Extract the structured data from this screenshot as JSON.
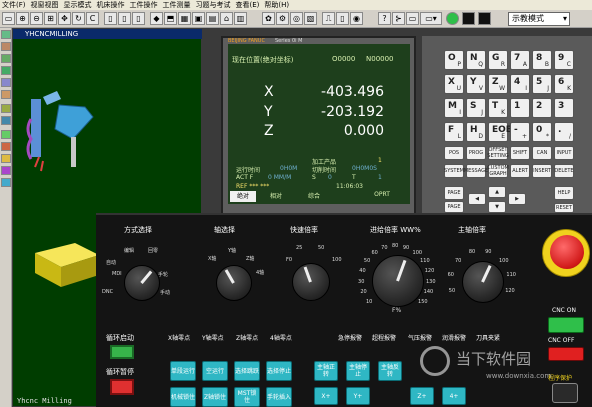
{
  "menubar": [
    "文件(F)",
    "视窗视图",
    "显示模式",
    "机床操作",
    "工件操作",
    "工件测量",
    "习题与考试",
    "查看(E)",
    "帮助(H)"
  ],
  "toolbar": {
    "mode_select": "示教模式"
  },
  "viewport": {
    "title": "YHCNCMILLING",
    "watermark": "Yhcnc Milling"
  },
  "cnc": {
    "header_logo": "BEIJING FANUC",
    "header_series": "Series 0i M",
    "screen_title": "现在位置(绝对坐标)",
    "program_no": "O0000",
    "seq_no": "N00000",
    "axes": [
      {
        "name": "X",
        "value": "-403.496"
      },
      {
        "name": "Y",
        "value": "-203.192"
      },
      {
        "name": "Z",
        "value": "0.000"
      }
    ],
    "run_time_label": "运行时间",
    "run_time": "0H0M",
    "parts_label": "加工产品",
    "parts_count": "1",
    "cycle_time_label": "切削时间",
    "cycle_time": "0H0M0S",
    "act_f_label": "ACT F",
    "act_f": "0 MM/M",
    "s_label": "S",
    "s_value": "0",
    "t_label": "T",
    "t_value": "1",
    "ref_label": "REF *** ***",
    "clock": "11:06:03",
    "softkeys": [
      "绝对",
      "相对",
      "综合",
      "",
      "OPRT"
    ]
  },
  "keypad": {
    "rows": [
      [
        {
          "k": "O",
          "s": "P"
        },
        {
          "k": "N",
          "s": "Q"
        },
        {
          "k": "G",
          "s": "R"
        },
        {
          "k": "7",
          "s": "A"
        },
        {
          "k": "8",
          "s": "B"
        },
        {
          "k": "9",
          "s": "C"
        }
      ],
      [
        {
          "k": "X",
          "s": "U"
        },
        {
          "k": "Y",
          "s": "V"
        },
        {
          "k": "Z",
          "s": "W"
        },
        {
          "k": "4",
          "s": "I"
        },
        {
          "k": "5",
          "s": "J"
        },
        {
          "k": "6",
          "s": "K"
        }
      ],
      [
        {
          "k": "M",
          "s": "I"
        },
        {
          "k": "S",
          "s": "J"
        },
        {
          "k": "T",
          "s": "K"
        },
        {
          "k": "1",
          "s": ""
        },
        {
          "k": "2",
          "s": ""
        },
        {
          "k": "3",
          "s": ""
        }
      ],
      [
        {
          "k": "F",
          "s": "L"
        },
        {
          "k": "H",
          "s": "D"
        },
        {
          "k": "EOB",
          "s": "E"
        },
        {
          "k": "-",
          "s": "+"
        },
        {
          "k": "0",
          "s": "*"
        },
        {
          "k": ".",
          "s": "/"
        }
      ]
    ],
    "func_row1": [
      "POS",
      "PROG",
      "OFFSET SETTING",
      "SHIFT",
      "CAN",
      "INPUT"
    ],
    "func_row2": [
      "SYSTEM",
      "MESSAGE",
      "CUSTOM GRAPH",
      "ALERT",
      "INSERT",
      "DELETE"
    ],
    "page_up": "PAGE",
    "page_down": "PAGE",
    "help": "HELP",
    "reset": "RESET"
  },
  "machine_panel": {
    "mode_label": "方式选择",
    "mode_ticks": [
      "编辑",
      "回零",
      "手轮",
      "自动",
      "MDI",
      "DNC",
      "手动"
    ],
    "axis_label": "轴选择",
    "axis_ticks": [
      "X轴",
      "Y轴",
      "Z轴",
      "4轴"
    ],
    "rapid_label": "快速倍率",
    "rapid_ticks": [
      "F0",
      "25",
      "50",
      "100"
    ],
    "feed_label": "进给倍率 WW%",
    "feed_ticks": [
      "10",
      "20",
      "30",
      "40",
      "50",
      "60",
      "70",
      "80",
      "90",
      "100",
      "110",
      "120",
      "130",
      "140",
      "150"
    ],
    "feed_unit": "F%",
    "spindle_label": "主轴倍率",
    "spindle_ticks": [
      "50",
      "60",
      "70",
      "80",
      "90",
      "100",
      "110",
      "120"
    ],
    "cycle_start": "循环启动",
    "cycle_hold": "循环暂停",
    "zero_labels": [
      "X轴零点",
      "Y轴零点",
      "Z轴零点",
      "4轴零点"
    ],
    "alarm_labels": [
      "急停报警",
      "超程报警",
      "气压报警",
      "润滑报警",
      "刀具夹紧"
    ],
    "buttons_row1": [
      "单段运行",
      "空运行",
      "选择跳跃",
      "选择停止"
    ],
    "buttons_row2": [
      "机械锁住",
      "Z轴锁住",
      "MST锁住",
      "手轮插入"
    ],
    "spindle_buttons": [
      "主轴正转",
      "主轴停止",
      "主轴反转"
    ],
    "jog_buttons": [
      "X+",
      "Y+",
      "Z+",
      "4+"
    ],
    "cnc_on": "CNC ON",
    "cnc_off": "CNC OFF",
    "program_protect": "程序保护"
  },
  "watermark": {
    "text": "当下软件园",
    "url": "www.downxia.com"
  },
  "colors": {
    "screen_bg": "#1e3f1c",
    "viewport_bg": "#003d00",
    "accent_teal": "#2fb7c4",
    "green": "#2fbf4a",
    "red": "#e02020",
    "yellow": "#f0d21e"
  }
}
